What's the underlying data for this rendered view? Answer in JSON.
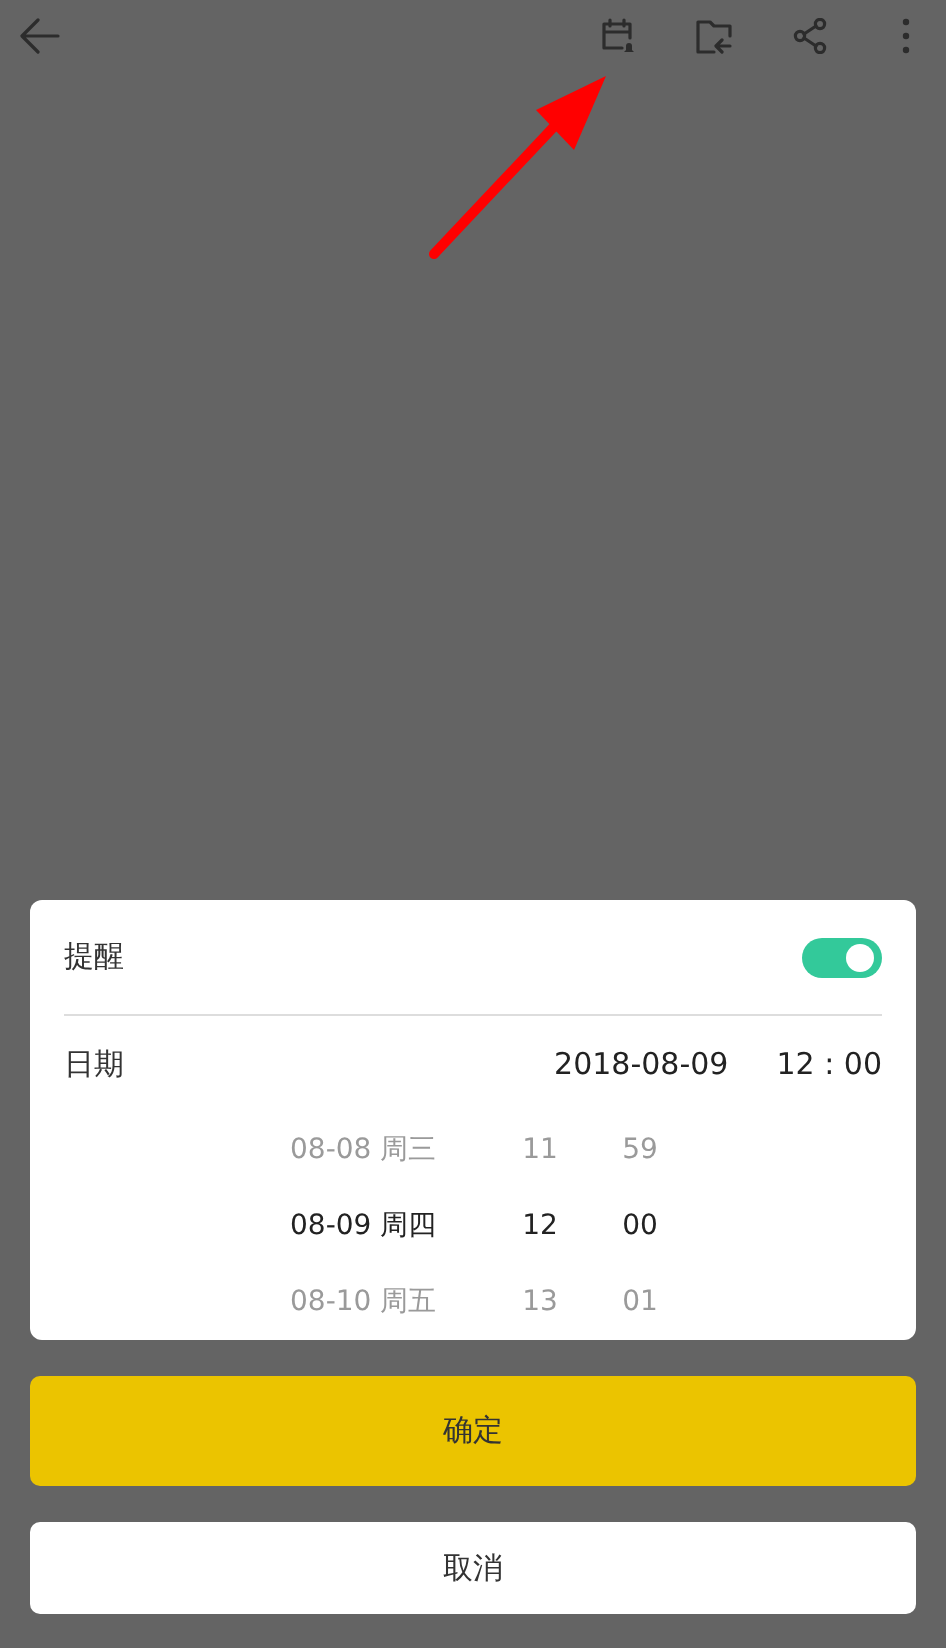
{
  "toolbar": {
    "actions": [
      {
        "kind": "back"
      },
      {
        "kind": "reminder"
      },
      {
        "kind": "folder"
      },
      {
        "kind": "share"
      },
      {
        "kind": "more"
      }
    ]
  },
  "annotation": {
    "kind": "arrow"
  },
  "reminder_dialog": {
    "reminder_label": "提醒",
    "reminder_on": true,
    "date_label": "日期",
    "date_value": "2018-08-09",
    "time_value": "12 : 00",
    "picker": [
      {
        "date": "08-08 周三",
        "hour": "11",
        "minute": "59",
        "selected": false
      },
      {
        "date": "08-09 周四",
        "hour": "12",
        "minute": "00",
        "selected": true
      },
      {
        "date": "08-10 周五",
        "hour": "13",
        "minute": "01",
        "selected": false
      }
    ]
  },
  "buttons": [
    {
      "label": "确定",
      "kind": "primary"
    },
    {
      "label": "取消",
      "kind": "secondary"
    }
  ]
}
